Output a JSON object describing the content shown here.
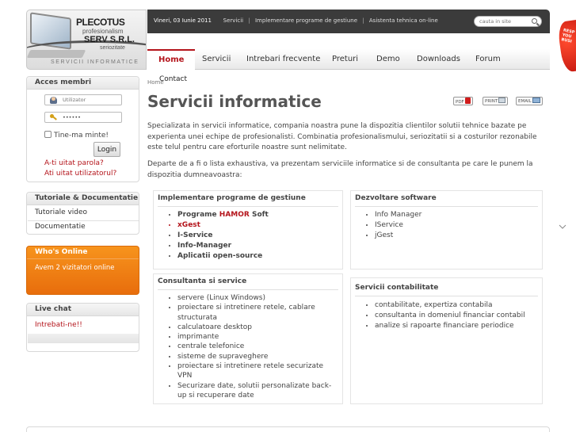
{
  "header": {
    "logo": {
      "line1": "PLECOTUS",
      "line2": "profesionalism",
      "line3": "SERV S.R.L.",
      "line4": "seriozitate",
      "tagline": "SERVICII INFORMATICE"
    },
    "topbar": {
      "date": "Vineri, 03 Iunie 2011",
      "links": [
        "Servicii",
        "Implementare programe de gestiune",
        "Asistenta tehnica on-line"
      ]
    },
    "search": {
      "placeholder": "cauta in site"
    },
    "nav": [
      "Home",
      "Servicii",
      "Intrebari frecvente",
      "Preturi",
      "Demo",
      "Downloads",
      "Forum"
    ],
    "promo": "RESP YOU BUSI"
  },
  "sidebar": {
    "login": {
      "title": "Acces membri",
      "username_placeholder": "Utilizator",
      "password_value": "••••••",
      "remember_label": "Tine-ma minte!",
      "login_button": "Login",
      "forgot_password": "A-ti uitat parola?",
      "forgot_username": "Ati uitat utilizatorul?"
    },
    "tutorials": {
      "title": "Tutoriale & Documentatie",
      "items": [
        "Tutoriale video",
        "Documentatie"
      ]
    },
    "whos_online": {
      "title": "Who's Online",
      "text": "Avem 2 vizitatori online"
    },
    "live_chat": {
      "title": "Live chat",
      "link": "Intrebati-ne!!"
    }
  },
  "main": {
    "breadcrumb": "Home",
    "breadcrumb_extra": "Contact",
    "title": "Servicii informatice",
    "doc_buttons": [
      "PDF",
      "PRINT",
      "EMAIL"
    ],
    "intro": "Specializata in servicii informatice, compania noastra pune la dispozitia clientilor solutii tehnice bazate pe experienta unei echipe de profesionalisti. Combinatia profesionalismului, seriozitatii si a costurilor rezonabile este telul pentru care eforturile noastre sunt nelimitate.",
    "intro2": "Departe de a fi o lista exhaustiva, va prezentam serviciile informatice si de consultanta pe care le punem la dispozitia dumneavoastra:",
    "cards": [
      {
        "title": "Implementare programe de gestiune",
        "items": [
          "Programe ",
          "HAMOR",
          " Soft",
          "xGest",
          "I-Service",
          "Info-Manager",
          "Aplicatii open-source"
        ]
      },
      {
        "title": "Dezvoltare software",
        "items": [
          "Info Manager",
          "IService",
          "jGest"
        ]
      },
      {
        "title": "Consultanta si service",
        "items": [
          "servere (Linux Windows)",
          "proiectare si intretinere retele, cablare structurata",
          "calculatoare desktop",
          "imprimante",
          "centrale telefonice",
          "sisteme de supraveghere",
          "proiectare si intretinere retele securizate VPN",
          "Securizare date, solutii personalizate back-up si recuperare date"
        ]
      },
      {
        "title": "Servicii contabilitate",
        "items": [
          "contabilitate, expertiza contabila",
          "consultanta in domeniul financiar contabil",
          "analize si rapoarte financiare periodice"
        ]
      }
    ]
  }
}
